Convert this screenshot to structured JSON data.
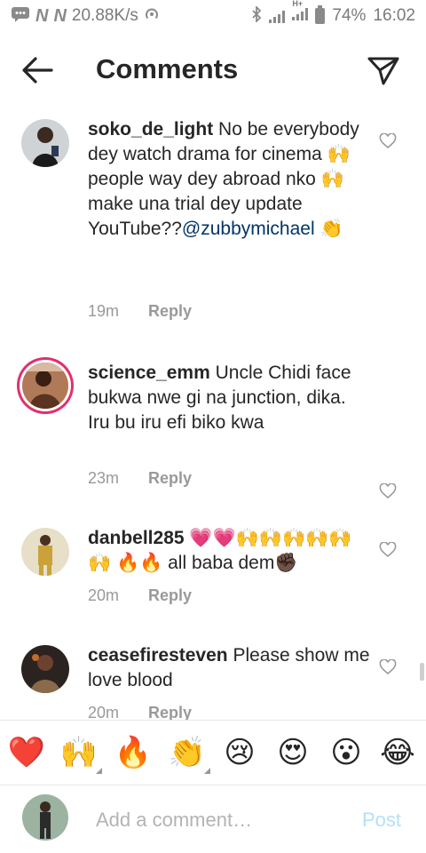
{
  "status_bar": {
    "speed": "20.88K/s",
    "battery": "74%",
    "time": "16:02",
    "network_badge": "H+",
    "icons": [
      "chat-icon",
      "n-icon",
      "n-icon",
      "hotspot-icon",
      "bluetooth-icon",
      "signal-icon",
      "signal-icon",
      "battery-icon"
    ]
  },
  "header": {
    "title": "Comments",
    "back_icon": "arrow-left-icon",
    "share_icon": "paper-plane-icon"
  },
  "comments": [
    {
      "user": "soko_de_light",
      "text": " No be everybody dey watch drama for cinema 🙌 people way dey abroad nko 🙌 make una trial dey update YouTube??",
      "mention": "@zubbymichael",
      "tail": " 👏",
      "time": "19m",
      "reply": "Reply"
    },
    {
      "user": "science_emm",
      "text": " Uncle Chidi face bukwa nwe gi na junction, dika. Iru bu iru efi biko kwa",
      "mention": "",
      "tail": "",
      "time": "23m",
      "reply": "Reply"
    },
    {
      "user": "danbell285",
      "text": " 💗💗🙌🙌🙌🙌🙌🙌 🔥🔥 all baba dem✊🏿",
      "mention": "",
      "tail": "",
      "time": "20m",
      "reply": "Reply"
    },
    {
      "user": "ceasefiresteven",
      "text": " Please show me love blood",
      "mention": "",
      "tail": "",
      "time": "20m",
      "reply": "Reply"
    }
  ],
  "emoji_bar": [
    "❤️",
    "🙌",
    "🔥",
    "👏",
    "😢",
    "😍",
    "😮",
    "😂"
  ],
  "compose": {
    "placeholder": "Add a comment…",
    "post_label": "Post"
  },
  "colors": {
    "mention": "#003569",
    "post_disabled": "#b2dffc",
    "story_ring": "#e1306c"
  }
}
